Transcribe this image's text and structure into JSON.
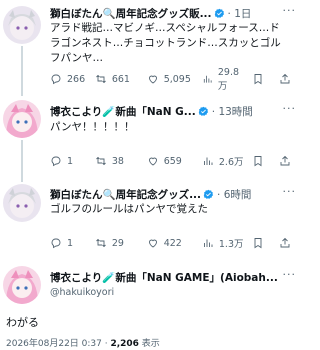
{
  "tweets": [
    {
      "name": "獅白ぼたん🔍周年記念グッズ販...",
      "time": "· 1日",
      "text": "アラド戦記…マビノギ…スペシャルフォース…ドラゴンネスト…チョコットランド…スカッとゴルフパンヤ…",
      "replies": "266",
      "retweets": "661",
      "likes": "5,095",
      "views": "29.8万"
    },
    {
      "name": "博衣こより🧪新曲「NaN G...",
      "time": "· 13時間",
      "text": "パンヤ！！！！！",
      "replies": "1",
      "retweets": "38",
      "likes": "659",
      "views": "2.6万"
    },
    {
      "name": "獅白ぼたん🔍周年記念グッズ...",
      "time": "· 6時間",
      "text": "ゴルフのルールはパンヤで覚えた",
      "replies": "1",
      "retweets": "29",
      "likes": "422",
      "views": "1.3万"
    }
  ],
  "main_tweet": {
    "name": "博衣こより🧪新曲「NaN GAME」(Aiobah...",
    "handle": "@hakuikoyori",
    "text": "わがる",
    "timestamp": "2026年08月22日 0:37 · ",
    "views_count": "2,206",
    "views_label": " 表示"
  },
  "colors": {
    "text": "#0f1419",
    "muted": "#536471",
    "verified": "#1d9bf0",
    "divider": "#eff3f4",
    "thread": "#cfd9de"
  },
  "icons": [
    "reply-icon",
    "retweet-icon",
    "like-icon",
    "views-icon",
    "bookmark-icon",
    "share-icon",
    "verified-icon",
    "more-icon"
  ]
}
